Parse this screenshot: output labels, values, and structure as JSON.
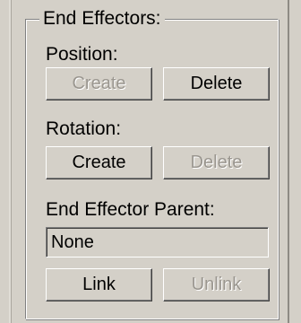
{
  "group": {
    "title": "End Effectors:"
  },
  "position": {
    "label": "Position:",
    "create_label": "Create",
    "create_enabled": false,
    "delete_label": "Delete",
    "delete_enabled": true
  },
  "rotation": {
    "label": "Rotation:",
    "create_label": "Create",
    "create_enabled": true,
    "delete_label": "Delete",
    "delete_enabled": false
  },
  "parent": {
    "label": "End Effector Parent:",
    "value": "None",
    "link_label": "Link",
    "link_enabled": true,
    "unlink_label": "Unlink",
    "unlink_enabled": false
  },
  "colors": {
    "background": "#d4d0c8",
    "disabled_text": "#9a968f"
  }
}
